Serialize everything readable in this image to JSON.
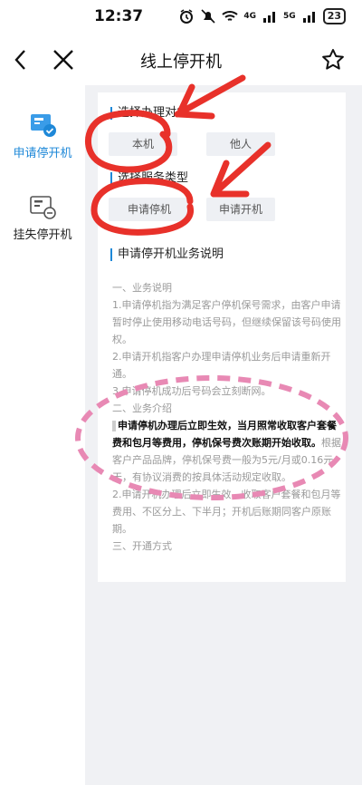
{
  "status_bar": {
    "time": "12:37",
    "network_1": "4G",
    "network_2": "5G",
    "battery": "23"
  },
  "nav": {
    "title": "线上停开机",
    "icons": [
      "back-icon",
      "close-icon",
      "star-icon"
    ]
  },
  "sidebar": {
    "items": [
      {
        "label": "申请停开机",
        "icon": "card-check-icon",
        "active": true
      },
      {
        "label": "挂失停开机",
        "icon": "card-minus-icon",
        "active": false
      }
    ]
  },
  "form": {
    "target_title": "选择办理对象",
    "target_options": [
      "本机",
      "他人"
    ],
    "service_title": "选择服务类型",
    "service_options": [
      "申请停机",
      "申请开机"
    ]
  },
  "description": {
    "title": "申请停开机业务说明",
    "lines": {
      "l1": "一、业务说明",
      "l2": "1.申请停机指为满足客户停机保号需求，由客户申请暂时停止使用移动电话号码，但继续保留该号码使用权。",
      "l3": "2.申请开机指客户办理申请停机业务后申请重新开通。",
      "l4": "3.申请停机成功后号码会立刻断网。",
      "l5": "二、业务介绍",
      "l6_bold": "申请停机办理后立即生效，当月照常收取客户套餐费和包月等费用，停机保号费次账期开始收取。",
      "l6_rest": "根据客户产品品牌，停机保号费一般为5元/月或0.16元/天，有协议消费的按具体活动规定收取。",
      "l7": "2.申请开机办理后立即生效，收取客户套餐和包月等费用、不区分上、下半月；开机后账期同客户原账期。",
      "l8": "三、开通方式"
    }
  },
  "colors": {
    "accent": "#1e88d8",
    "annotation_red": "#e8312a",
    "annotation_pink": "#e889b4",
    "content_bg": "#f0f1f4"
  }
}
